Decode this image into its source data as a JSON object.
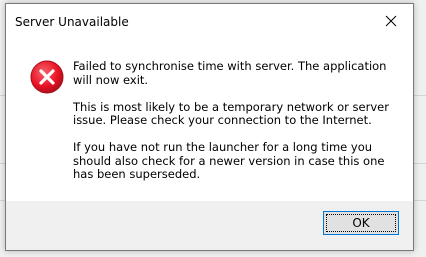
{
  "dialog": {
    "title": "Server Unavailable",
    "icon": "error-icon",
    "messages": [
      "Failed to synchronise time with server. The application will now exit.",
      "This is most likely to be a temporary network or server issue. Please check your connection to the Internet.",
      "If you have not run the launcher for a long time you should also check for a newer version in case this one has been superseded."
    ],
    "ok_label": "OK"
  },
  "colors": {
    "error_red": "#e81123",
    "button_border": "#0078d7",
    "footer_bg": "#f0f0f0"
  }
}
